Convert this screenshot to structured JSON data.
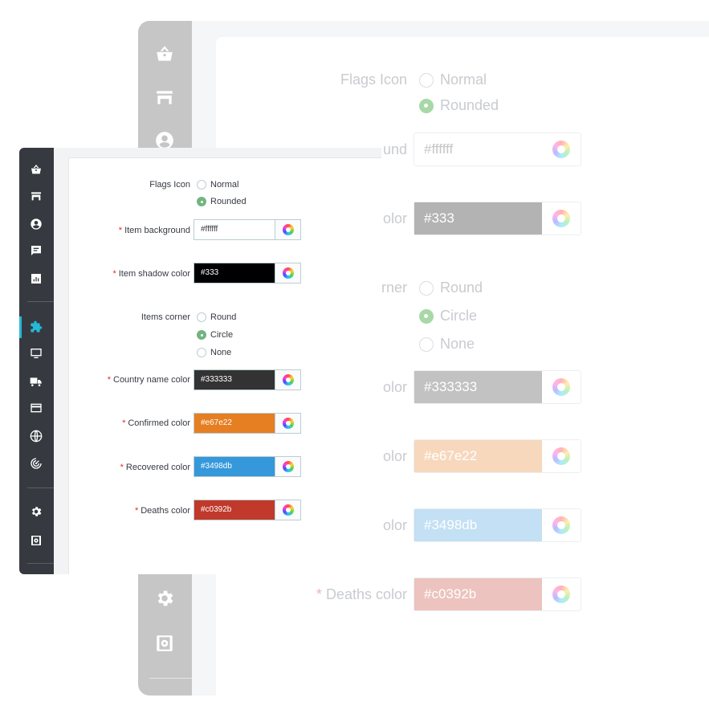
{
  "form": {
    "flags_icon": {
      "label": "Flags Icon",
      "options": [
        "Normal",
        "Rounded"
      ],
      "selected": "Rounded"
    },
    "item_background": {
      "required": "*",
      "label": "Item background",
      "value": "#ffffff",
      "color": "#ffffff"
    },
    "item_shadow_color": {
      "required": "*",
      "label": "Item shadow color",
      "value": "#333",
      "color": "#000000"
    },
    "items_corner": {
      "label": "Items corner",
      "options": [
        "Round",
        "Circle",
        "None"
      ],
      "selected": "Circle"
    },
    "country_name_color": {
      "required": "*",
      "label": "Country name color",
      "value": "#333333",
      "color": "#333333"
    },
    "confirmed_color": {
      "required": "*",
      "label": "Confirmed color",
      "value": "#e67e22",
      "color": "#e67e22"
    },
    "recovered_color": {
      "required": "*",
      "label": "Recovered color",
      "value": "#3498db",
      "color": "#3498db"
    },
    "deaths_color": {
      "required": "*",
      "label": "Deaths color",
      "value": "#c0392b",
      "color": "#c0392b"
    }
  },
  "background_zoom": {
    "flags_label": "Flags Icon",
    "flags_opt1": "Normal",
    "flags_opt2": "Rounded",
    "item_bg_label_fragment": "und",
    "item_bg_value": "#ffffff",
    "shadow_label_fragment": "olor",
    "shadow_value": "#333",
    "corner_label_fragment": "rner",
    "corner_opt1": "Round",
    "corner_opt2": "Circle",
    "corner_opt3": "None",
    "country_label_fragment": "olor",
    "country_value": "#333333",
    "confirmed_label_fragment": "olor",
    "confirmed_value": "#e67e22",
    "recovered_label_fragment": "olor",
    "recovered_value": "#3498db",
    "deaths_required": "*",
    "deaths_label": "Deaths color",
    "deaths_value": "#c0392b"
  },
  "sidebar": {
    "icons": [
      "shopping-basket-icon",
      "store-icon",
      "user-circle-icon",
      "message-icon",
      "stats-icon",
      "puzzle-icon",
      "desktop-icon",
      "truck-icon",
      "credit-card-icon",
      "globe-icon",
      "radar-icon",
      "settings-icon",
      "advanced-settings-icon"
    ],
    "active": "puzzle-icon",
    "accent": "#25b9d7"
  }
}
